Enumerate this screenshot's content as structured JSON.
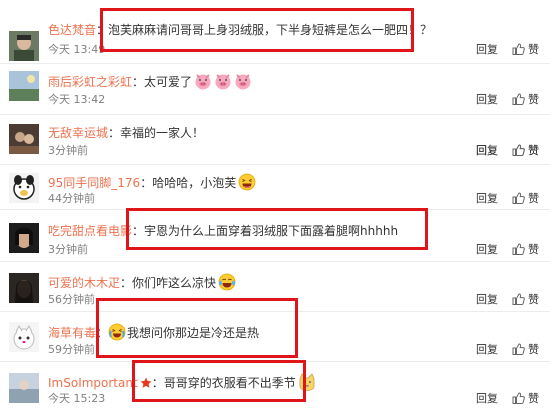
{
  "common": {
    "sep": "：",
    "reply_label": "回复",
    "like_label": "赞"
  },
  "comments": [
    {
      "user": "色达梵音",
      "content": "泡芙麻麻请问哥哥上身羽绒服，下半身短裤是怎么一肥四！？",
      "time": "今天 13:49"
    },
    {
      "user": "雨后彩虹之彩虹",
      "content": "太可爱了",
      "emojis": [
        "pig-face-icon",
        "pig-face-icon",
        "pig-face-icon"
      ],
      "time": "今天 13:42"
    },
    {
      "user": "无敌幸运城",
      "content": "幸福的一家人！",
      "time": "3分钟前"
    },
    {
      "user": "95同手同脚_176",
      "content": "哈哈哈，小泡芙",
      "emojis": [
        "laughing-face-icon"
      ],
      "time": "44分钟前"
    },
    {
      "user": "吃完甜点看电影",
      "content": "宇恩为什么上面穿着羽绒服下面露着腿啊hhhhh",
      "time": "3分钟前"
    },
    {
      "user": "可爱的木木疋",
      "content": "你们咋这么凉快",
      "emojis": [
        "tears-of-joy-icon"
      ],
      "time": "56分钟前"
    },
    {
      "user": "海草有毒",
      "emojis_before": [
        "crying-laugh-icon"
      ],
      "content": "我想问你那边是冷还是热",
      "time": "59分钟前"
    },
    {
      "user": "ImSoImportant",
      "badge": "star-badge-icon",
      "content": "哥哥穿的衣服看不出季节",
      "emojis": [
        "doge-cat-icon"
      ],
      "time": "今天 15:23"
    }
  ],
  "colors": {
    "username": "#eb7350",
    "highlight_box": "#e0151a",
    "meta": "#808080"
  }
}
